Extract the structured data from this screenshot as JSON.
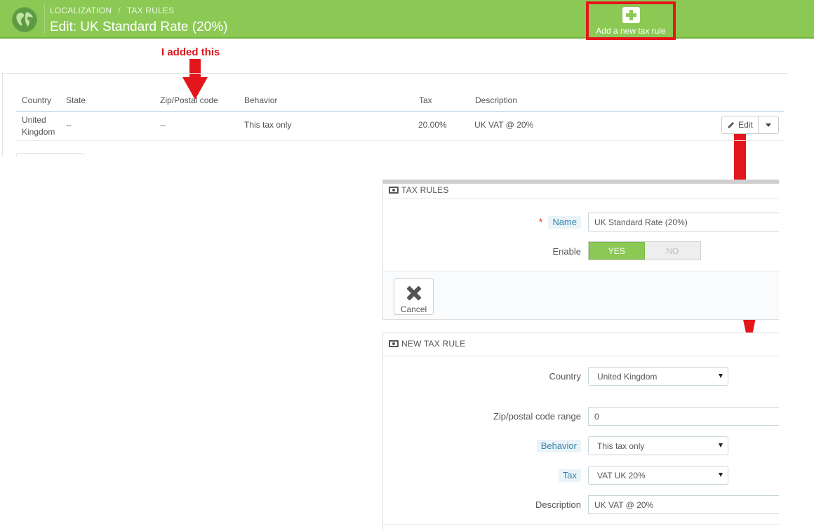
{
  "header": {
    "breadcrumb": [
      "LOCALIZATION",
      "TAX RULES"
    ],
    "title": "Edit: UK Standard Rate (20%)",
    "add_button_label": "Add a new tax rule",
    "accent": "#8bc954"
  },
  "annotation": {
    "note": "I added this",
    "color": "#e3161c"
  },
  "rules_table": {
    "columns": [
      "Country",
      "State",
      "Zip/Postal code",
      "Behavior",
      "Tax",
      "Description"
    ],
    "rows": [
      {
        "country_line1": "United",
        "country_line2": "Kingdom",
        "state": "--",
        "zip": "--",
        "behavior": "This tax only",
        "tax": "20.00%",
        "description": "UK VAT @ 20%",
        "edit_label": "Edit"
      }
    ]
  },
  "tax_rules_panel": {
    "heading": "TAX RULES",
    "name_label": "Name",
    "name_required_mark": "*",
    "name_value": "UK Standard Rate (20%)",
    "enable_label": "Enable",
    "enable_yes": "YES",
    "enable_no": "NO",
    "enabled": true,
    "cancel_label": "Cancel"
  },
  "new_tax_rule_panel": {
    "heading": "NEW TAX RULE",
    "country_label": "Country",
    "country_value": "United Kingdom",
    "zip_label": "Zip/postal code range",
    "zip_value": "0",
    "behavior_label": "Behavior",
    "behavior_value": "This tax only",
    "tax_label": "Tax",
    "tax_value": "VAT UK 20%",
    "description_label": "Description",
    "description_value": "UK VAT @ 20%"
  }
}
